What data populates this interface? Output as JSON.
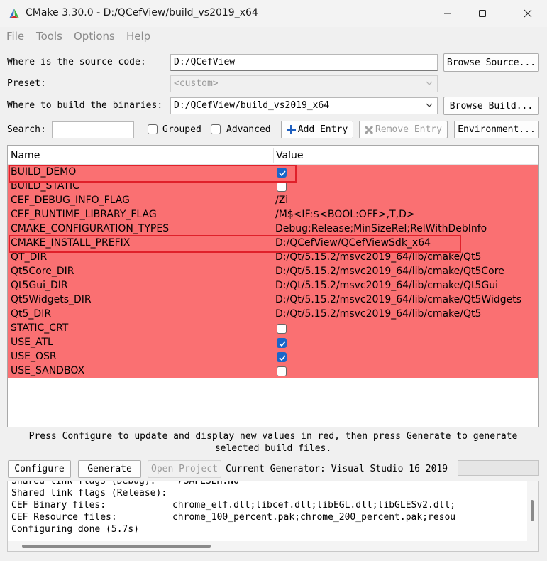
{
  "window": {
    "title": "CMake 3.30.0 - D:/QCefView/build_vs2019_x64",
    "minimize_glyph": "─",
    "maximize_glyph": "☐",
    "close_glyph": "✕"
  },
  "menu": [
    "File",
    "Tools",
    "Options",
    "Help"
  ],
  "source": {
    "label": "Where is the source code:",
    "value": "D:/QCefView",
    "browse_label": "Browse Source..."
  },
  "preset": {
    "label": "Preset:",
    "value": "<custom>"
  },
  "binaries": {
    "label": "Where to build the binaries:",
    "value": "D:/QCefView/build_vs2019_x64",
    "browse_label": "Browse Build..."
  },
  "search": {
    "label": "Search:",
    "value": "",
    "grouped_label": "Grouped",
    "advanced_label": "Advanced",
    "add_entry_label": "Add Entry",
    "remove_entry_label": "Remove Entry",
    "environment_label": "Environment..."
  },
  "table": {
    "col_name": "Name",
    "col_value": "Value",
    "row_color": "#fa7072",
    "rows": [
      {
        "name": "BUILD_DEMO",
        "type": "bool",
        "checked": true
      },
      {
        "name": "BUILD_STATIC",
        "type": "bool",
        "checked": false
      },
      {
        "name": "CEF_DEBUG_INFO_FLAG",
        "type": "text",
        "value": "/Zi"
      },
      {
        "name": "CEF_RUNTIME_LIBRARY_FLAG",
        "type": "text",
        "value": "/M$<IF:$<BOOL:OFF>,T,D>"
      },
      {
        "name": "CMAKE_CONFIGURATION_TYPES",
        "type": "text",
        "value": "Debug;Release;MinSizeRel;RelWithDebInfo"
      },
      {
        "name": "CMAKE_INSTALL_PREFIX",
        "type": "text",
        "value": "D:/QCefView/QCefViewSdk_x64"
      },
      {
        "name": "QT_DIR",
        "type": "text",
        "value": "D:/Qt/5.15.2/msvc2019_64/lib/cmake/Qt5"
      },
      {
        "name": "Qt5Core_DIR",
        "type": "text",
        "value": "D:/Qt/5.15.2/msvc2019_64/lib/cmake/Qt5Core"
      },
      {
        "name": "Qt5Gui_DIR",
        "type": "text",
        "value": "D:/Qt/5.15.2/msvc2019_64/lib/cmake/Qt5Gui"
      },
      {
        "name": "Qt5Widgets_DIR",
        "type": "text",
        "value": "D:/Qt/5.15.2/msvc2019_64/lib/cmake/Qt5Widgets"
      },
      {
        "name": "Qt5_DIR",
        "type": "text",
        "value": "D:/Qt/5.15.2/msvc2019_64/lib/cmake/Qt5"
      },
      {
        "name": "STATIC_CRT",
        "type": "bool",
        "checked": false
      },
      {
        "name": "USE_ATL",
        "type": "bool",
        "checked": true
      },
      {
        "name": "USE_OSR",
        "type": "bool",
        "checked": true
      },
      {
        "name": "USE_SANDBOX",
        "type": "bool",
        "checked": false
      }
    ]
  },
  "hint": "Press Configure to update and display new values in red, then press Generate to generate selected build files.",
  "actions": {
    "configure_label": "Configure",
    "generate_label": "Generate",
    "open_project_label": "Open Project",
    "generator_text": "Current Generator: Visual Studio 16 2019"
  },
  "output": [
    "Shared link flags (Debug):    /SAFESEH:NO",
    "Shared link flags (Release):",
    "CEF Binary files:            chrome_elf.dll;libcef.dll;libEGL.dll;libGLESv2.dll;",
    "CEF Resource files:          chrome_100_percent.pak;chrome_200_percent.pak;resou",
    "Configuring done (5.7s)"
  ]
}
